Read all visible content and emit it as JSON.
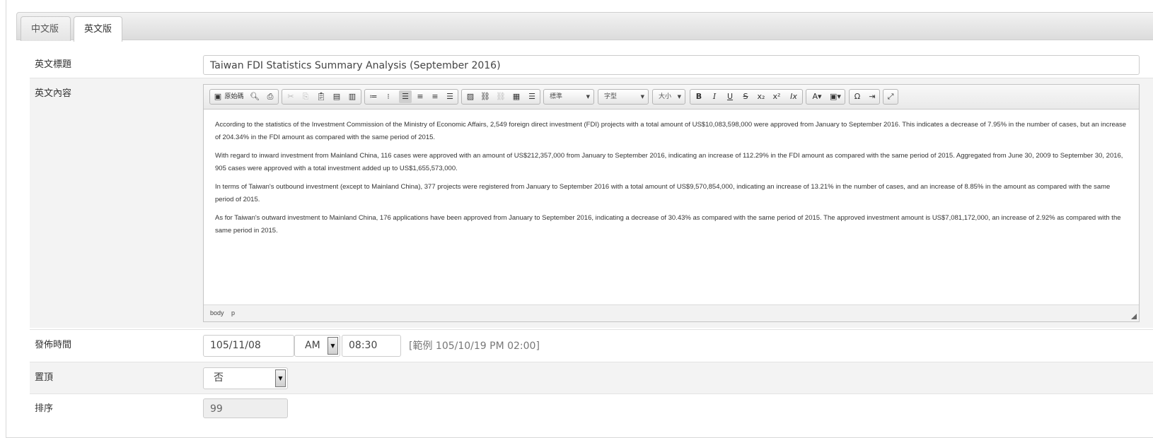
{
  "tabs": [
    {
      "label": "中文版",
      "active": false
    },
    {
      "label": "英文版",
      "active": true
    }
  ],
  "fields": {
    "title_label": "英文標題",
    "title_value": "Taiwan FDI Statistics Summary Analysis (September 2016)",
    "content_label": "英文內容",
    "publish_label": "發佈時間",
    "publish_date": "105/11/08",
    "publish_ampm": "AM",
    "publish_time": "08:30",
    "publish_hint": "[範例 105/10/19 PM 02:00]",
    "pin_label": "置頂",
    "pin_value": "否",
    "order_label": "排序",
    "order_value": "99"
  },
  "editor": {
    "toolbar": {
      "source_label": "原始碼",
      "format_combo": "標準",
      "font_combo": "字型",
      "size_combo": "大小"
    },
    "paragraphs": [
      "  According to the statistics of the Investment Commission of the Ministry of Economic Affairs, 2,549 foreign direct investment (FDI) projects with a total amount of US$10,083,598,000 were approved from January to September 2016. This indicates a decrease of 7.95% in the number of cases, but an increase of 204.34% in the FDI amount as compared with the same period of 2015.",
      "With regard to inward investment from Mainland China, 116 cases were approved with an amount of US$212,357,000 from January to September 2016, indicating an increase of 112.29% in the FDI amount as compared with the same period of 2015. Aggregated from June 30, 2009 to September 30, 2016, 905 cases were approved with a total investment added up to US$1,655,573,000.",
      "In terms of Taiwan's outbound investment (except to Mainland China), 377 projects were registered from January to September 2016 with a total amount of US$9,570,854,000, indicating an increase of 13.21% in the number of cases, and an increase of 8.85% in the amount as compared with the same period of 2015.",
      "As for Taiwan's outward investment to Mainland China, 176 applications have been approved from January to September 2016, indicating a decrease of 30.43% as compared with the same period of 2015. The approved investment amount is US$7,081,172,000, an increase of 2.92% as compared with the same period in 2015."
    ],
    "status_path": [
      "body",
      "p"
    ]
  }
}
